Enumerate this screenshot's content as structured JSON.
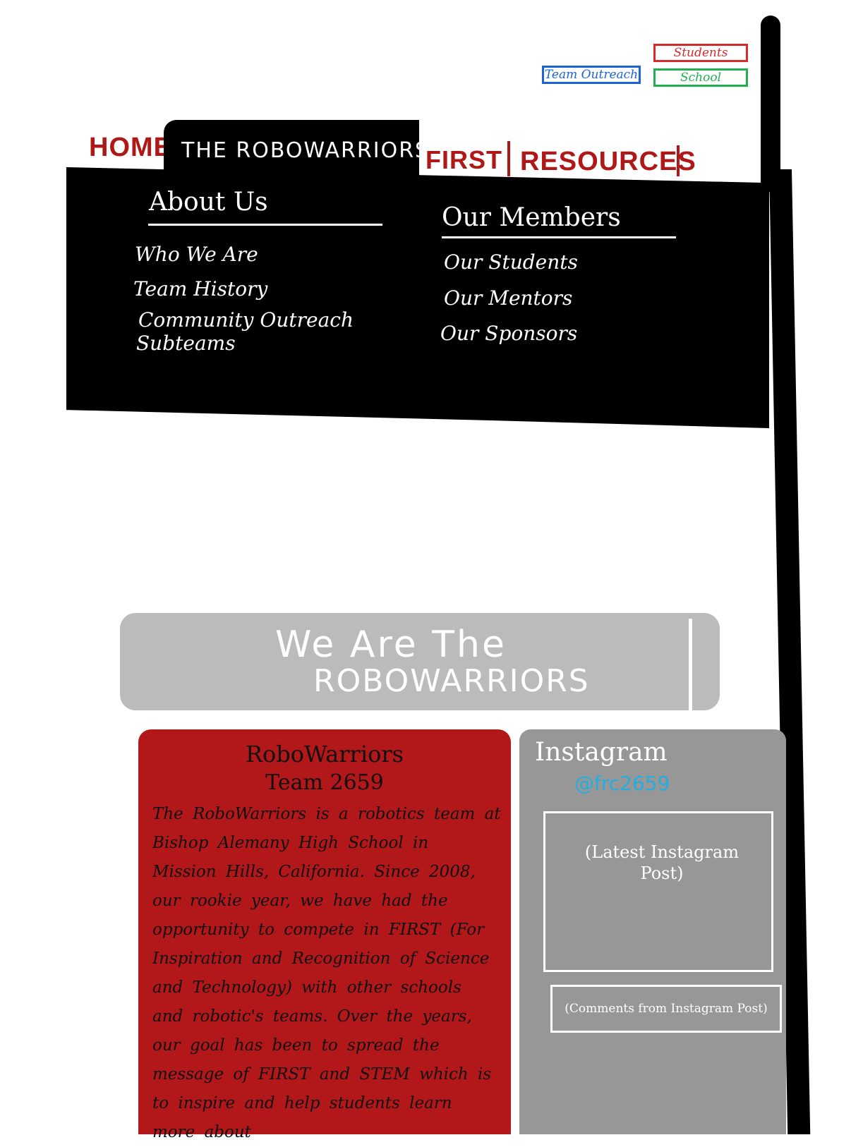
{
  "top_links": {
    "students": "Students",
    "team_outreach": "Team Outreach",
    "school": "School"
  },
  "nav": {
    "home": "HOME",
    "robowarriors": "THE ROBOWARRIORS",
    "first": "FIRST",
    "resources": "RESOURCES"
  },
  "dropdown": {
    "about": {
      "heading": "About Us",
      "items": [
        "Who We Are",
        "Team History",
        "Community Outreach",
        "Subteams"
      ]
    },
    "members": {
      "heading": "Our Members",
      "items": [
        "Our Students",
        "Our Mentors",
        "Our Sponsors"
      ]
    }
  },
  "hero": {
    "line1": "We Are The",
    "line2": "ROBOWARRIORS"
  },
  "about_card": {
    "title": "RoboWarriors",
    "subtitle": "Team 2659",
    "body": "The RoboWarriors is a robotics team at Bishop Alemany High School in Mission Hills, California. Since 2008, our rookie year, we have had the opportunity to compete in FIRST (For Inspiration and Recognition of Science and Technology) with other schools and robotic's teams. Over the years, our goal has been to spread the message of FIRST and STEM which is to inspire and help students learn more about"
  },
  "instagram": {
    "title": "Instagram",
    "handle": "@frc2659",
    "post_placeholder": "(Latest Instagram Post)",
    "comments_placeholder": "(Comments from Instagram Post)"
  },
  "colors": {
    "brand_red": "#b01818",
    "card_red": "#b2171a",
    "hero_gray": "#bbbbbb",
    "instagram_gray": "#979797",
    "handle_blue": "#22aee0",
    "students_red": "#d62b2b",
    "outreach_blue": "#1a63d6",
    "school_green": "#20b050"
  }
}
